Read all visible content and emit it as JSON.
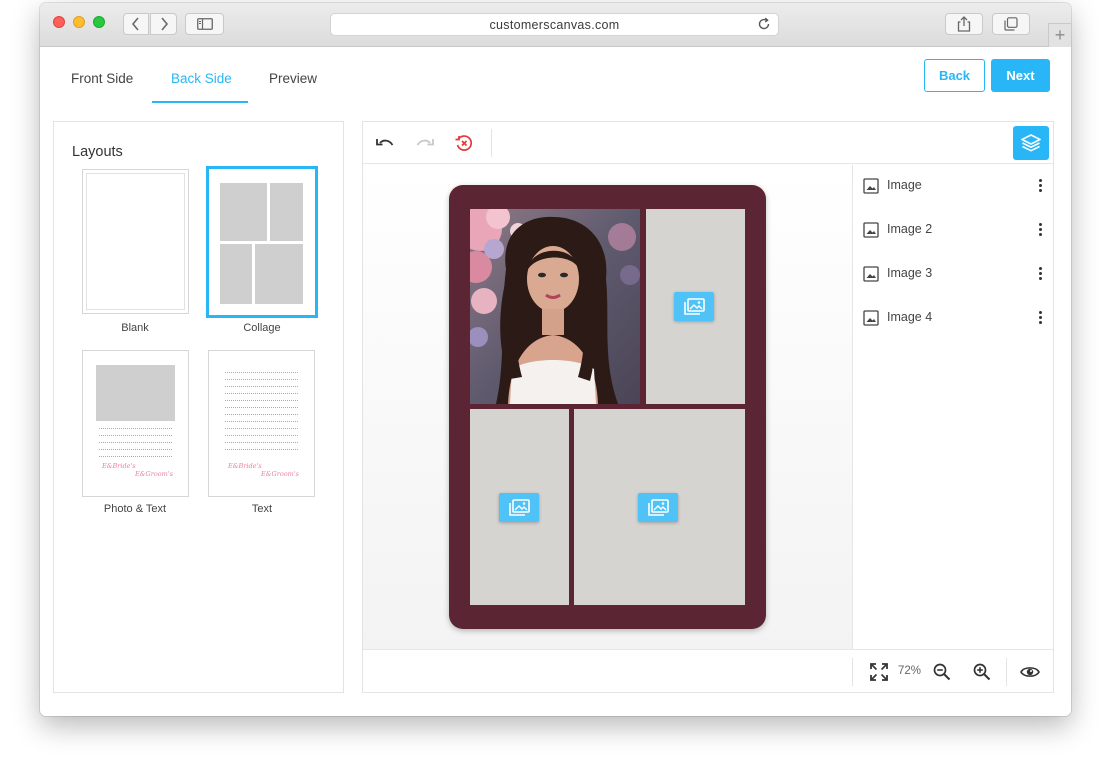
{
  "browser": {
    "url": "customerscanvas.com"
  },
  "tabs": [
    {
      "label": "Front Side",
      "active": false
    },
    {
      "label": "Back Side",
      "active": true
    },
    {
      "label": "Preview",
      "active": false
    }
  ],
  "actions": {
    "back_label": "Back",
    "next_label": "Next"
  },
  "layouts": {
    "title": "Layouts",
    "items": [
      {
        "label": "Blank",
        "selected": false
      },
      {
        "label": "Collage",
        "selected": true
      },
      {
        "label": "Photo & Text",
        "selected": false
      },
      {
        "label": "Text",
        "selected": false
      }
    ],
    "thumb_script_1": "E&Bride's",
    "thumb_script_2": "E&Groom's"
  },
  "toolbar": {
    "icons": [
      "undo-icon",
      "redo-icon",
      "revert-icon",
      "layers-icon"
    ]
  },
  "layers": [
    {
      "label": "Image"
    },
    {
      "label": "Image 2"
    },
    {
      "label": "Image 3"
    },
    {
      "label": "Image 4"
    }
  ],
  "zoom": {
    "value": "72%"
  },
  "colors": {
    "accent": "#29b6f6",
    "card_background": "#5b2533",
    "placeholder": "#d6d4d0"
  }
}
